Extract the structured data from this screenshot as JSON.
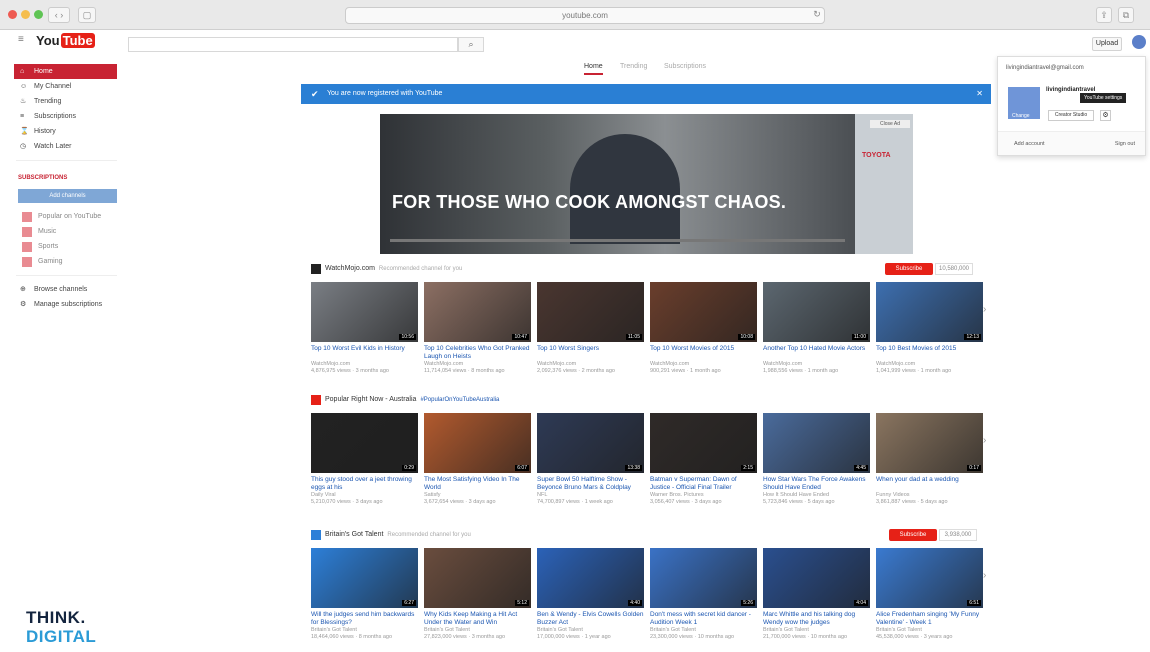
{
  "browser": {
    "url": "youtube.com"
  },
  "youtube": {
    "logo_you": "You",
    "logo_tube": "Tube",
    "search_placeholder": "",
    "upload_label": "Upload"
  },
  "sidebar": {
    "items": [
      {
        "label": "Home",
        "icon": "home-icon",
        "glyph": "⌂"
      },
      {
        "label": "My Channel",
        "icon": "person-icon",
        "glyph": "☺"
      },
      {
        "label": "Trending",
        "icon": "flame-icon",
        "glyph": "♨"
      },
      {
        "label": "Subscriptions",
        "icon": "subscriptions-icon",
        "glyph": "≡"
      },
      {
        "label": "History",
        "icon": "history-icon",
        "glyph": "⌛"
      },
      {
        "label": "Watch Later",
        "icon": "clock-icon",
        "glyph": "◷"
      }
    ],
    "subscriptions_heading": "SUBSCRIPTIONS",
    "browse_button": "Add channels",
    "subscriptions": [
      {
        "label": "Popular on YouTube"
      },
      {
        "label": "Music"
      },
      {
        "label": "Sports"
      },
      {
        "label": "Gaming"
      }
    ],
    "bottom": [
      {
        "label": "Browse channels",
        "glyph": "⊕"
      },
      {
        "label": "Manage subscriptions",
        "glyph": "⚙"
      }
    ]
  },
  "branding": {
    "think": "THINK.",
    "digital": "DIGITAL"
  },
  "tabs": [
    {
      "label": "Home"
    },
    {
      "label": "Trending"
    },
    {
      "label": "Subscriptions"
    }
  ],
  "banner": {
    "text": "You are now registered with YouTube"
  },
  "hero": {
    "headline": "FOR THOSE WHO COOK AMONGST CHAOS.",
    "brand": "TOYOTA",
    "close_label": "Close Ad"
  },
  "shelves": [
    {
      "title": "WatchMojo.com",
      "note": "Recommended channel for you",
      "subscribe_label": "Subscribe",
      "subscriber_count": "10,580,000",
      "videos": [
        {
          "title": "Top 10 Worst Evil Kids in History",
          "channel": "WatchMojo.com",
          "meta": "4,876,975 views · 3 months ago",
          "duration": "10:56",
          "color": "#7a7e84"
        },
        {
          "title": "Top 10 Celebrities Who Got Pranked Laugh on Heists",
          "channel": "WatchMojo.com",
          "meta": "11,714,054 views · 8 months ago",
          "duration": "10:47",
          "color": "#8c6f63"
        },
        {
          "title": "Top 10 Worst Singers",
          "channel": "WatchMojo.com",
          "meta": "2,092,376 views · 2 months ago",
          "duration": "11:05",
          "color": "#4a3630"
        },
        {
          "title": "Top 10 Worst Movies of 2015",
          "channel": "WatchMojo.com",
          "meta": "900,291 views · 1 month ago",
          "duration": "10:08",
          "color": "#6a3e2c"
        },
        {
          "title": "Another Top 10 Hated Movie Actors",
          "channel": "WatchMojo.com",
          "meta": "1,988,556 views · 1 month ago",
          "duration": "11:00",
          "color": "#5c6770"
        },
        {
          "title": "Top 10 Best Movies of 2015",
          "channel": "WatchMojo.com",
          "meta": "1,041,999 views · 1 month ago",
          "duration": "12:13",
          "color": "#3d6fb0"
        }
      ]
    },
    {
      "title": "Popular Right Now - Australia",
      "note": "#PopularOnYouTubeAustralia",
      "videos": [
        {
          "title": "This guy stood over a jeet throwing eggs at his",
          "channel": "Daily Viral",
          "meta": "5,210,070 views · 3 days ago",
          "duration": "0:29",
          "color": "#222222"
        },
        {
          "title": "The Most Satisfying Video In The World",
          "channel": "Satisfy",
          "meta": "3,672,654 views · 3 days ago",
          "duration": "6:07",
          "color": "#b25a2e"
        },
        {
          "title": "Super Bowl 50 Halftime Show - Beyoncé Bruno Mars & Coldplay",
          "channel": "NFL",
          "meta": "74,700,897 views · 1 week ago",
          "duration": "13:38",
          "color": "#2e3a55"
        },
        {
          "title": "Batman v Superman: Dawn of Justice - Official Final Trailer",
          "channel": "Warner Bros. Pictures",
          "meta": "3,056,407 views · 3 days ago",
          "duration": "2:15",
          "color": "#2f2a28"
        },
        {
          "title": "How Star Wars The Force Awakens Should Have Ended",
          "channel": "How It Should Have Ended",
          "meta": "5,723,846 views · 5 days ago",
          "duration": "4:45",
          "color": "#4a6b9c"
        },
        {
          "title": "When your dad at a wedding",
          "channel": "Funny Videos",
          "meta": "3,861,887 views · 5 days ago",
          "duration": "0:17",
          "color": "#8a7560"
        }
      ]
    },
    {
      "title": "Britain's Got Talent",
      "note": "Recommended channel for you",
      "subscribe_label": "Subscribe",
      "subscriber_count": "3,938,000",
      "videos": [
        {
          "title": "Will the judges send him backwards for Blessings?",
          "channel": "Britain's Got Talent",
          "meta": "18,464,060 views · 8 months ago",
          "duration": "6:27",
          "color": "#2d7fd8"
        },
        {
          "title": "Why Kids Keep Making a Hit Act Under the Water and Win",
          "channel": "Britain's Got Talent",
          "meta": "27,823,000 views · 3 months ago",
          "duration": "5:12",
          "color": "#6a4d3e"
        },
        {
          "title": "Ben & Wendy - Elvis Cowells Golden Buzzer Act",
          "channel": "Britain's Got Talent",
          "meta": "17,000,000 views · 1 year ago",
          "duration": "4:40",
          "color": "#2b62b8"
        },
        {
          "title": "Don't mess with secret kid dancer - Audition Week 1",
          "channel": "Britain's Got Talent",
          "meta": "23,300,000 views · 10 months ago",
          "duration": "5:26",
          "color": "#3a72c6"
        },
        {
          "title": "Marc Whittle and his talking dog Wendy wow the judges",
          "channel": "Britain's Got Talent",
          "meta": "21,700,000 views · 10 months ago",
          "duration": "4:04",
          "color": "#2a4f8f"
        },
        {
          "title": "Alice Fredenham singing 'My Funny Valentine' - Week 1",
          "channel": "Britain's Got Talent",
          "meta": "45,538,000 views · 3 years ago",
          "duration": "6:51",
          "color": "#3a7ad0"
        }
      ]
    }
  ],
  "account_menu": {
    "email": "livingindiantravel@gmail.com",
    "name": "livingindiantravel",
    "tooltip": "YouTube settings",
    "change_label": "Change",
    "privacy_label": "Creator Studio",
    "add_account": "Add account",
    "sign_out": "Sign out"
  }
}
